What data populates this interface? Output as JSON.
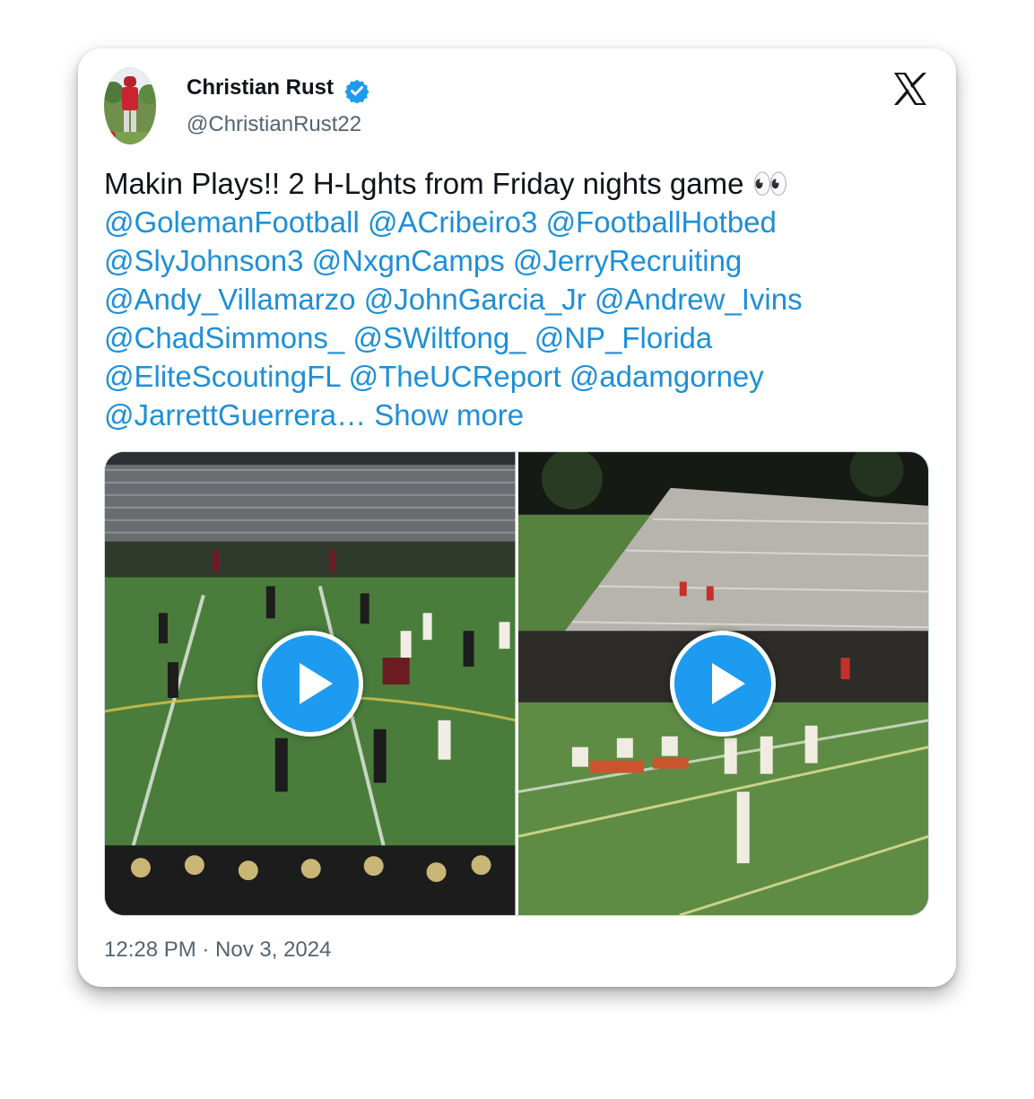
{
  "author": {
    "name": "Christian Rust",
    "handle": "@ChristianRust22",
    "verified": true,
    "avatar_icon": "football-player-avatar"
  },
  "platform_icon": "x-logo-icon",
  "tweet": {
    "text_lead": "Makin Plays!! 2 H-Lghts from Friday nights game 👀",
    "mention_lines": [
      [
        "@GolemanFootball",
        "@ACribeiro3",
        "@FootballHotbed"
      ],
      [
        "@SlyJohnson3",
        "@NxgnCamps",
        "@JerryRecruiting"
      ],
      [
        "@Andy_Villamarzo",
        "@JohnGarcia_Jr",
        "@Andrew_Ivins"
      ],
      [
        "@ChadSimmons_",
        "@SWiltfong_",
        "@NP_Florida"
      ],
      [
        "@EliteScoutingFL",
        "@TheUCReport",
        "@adamgorney"
      ]
    ],
    "truncated_mention": "@JarrettGuerrera…",
    "show_more_label": "Show more"
  },
  "media": [
    {
      "type": "video",
      "icon": "play-icon"
    },
    {
      "type": "video",
      "icon": "play-icon"
    }
  ],
  "timestamp": "12:28 PM · Nov 3, 2024",
  "colors": {
    "link": "#1d8fd8",
    "play_button": "#1d9bf0",
    "verified": "#1d9bf0",
    "text": "#0f1419",
    "secondary": "#536471"
  }
}
